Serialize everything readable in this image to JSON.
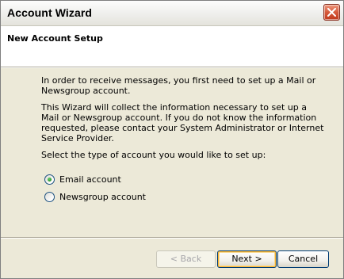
{
  "window": {
    "title": "Account Wizard"
  },
  "header": {
    "title": "New Account Setup"
  },
  "content": {
    "paragraph1": "In order to receive messages, you first need to set up a Mail or Newsgroup account.",
    "paragraph2": "This Wizard will collect the information necessary to set up a Mail or Newsgroup account. If you do not know the information requested, please contact your System Administrator or Internet Service Provider.",
    "prompt": "Select the type of account you would like to set up:"
  },
  "options": [
    {
      "label": "Email account",
      "selected": true
    },
    {
      "label": "Newsgroup account",
      "selected": false
    }
  ],
  "buttons": {
    "back": "< Back",
    "next": "Next >",
    "cancel": "Cancel"
  },
  "colors": {
    "close_button": "#d65a3c",
    "radio_selected": "#2c9a2c",
    "dialog_background": "#ece9d8"
  }
}
